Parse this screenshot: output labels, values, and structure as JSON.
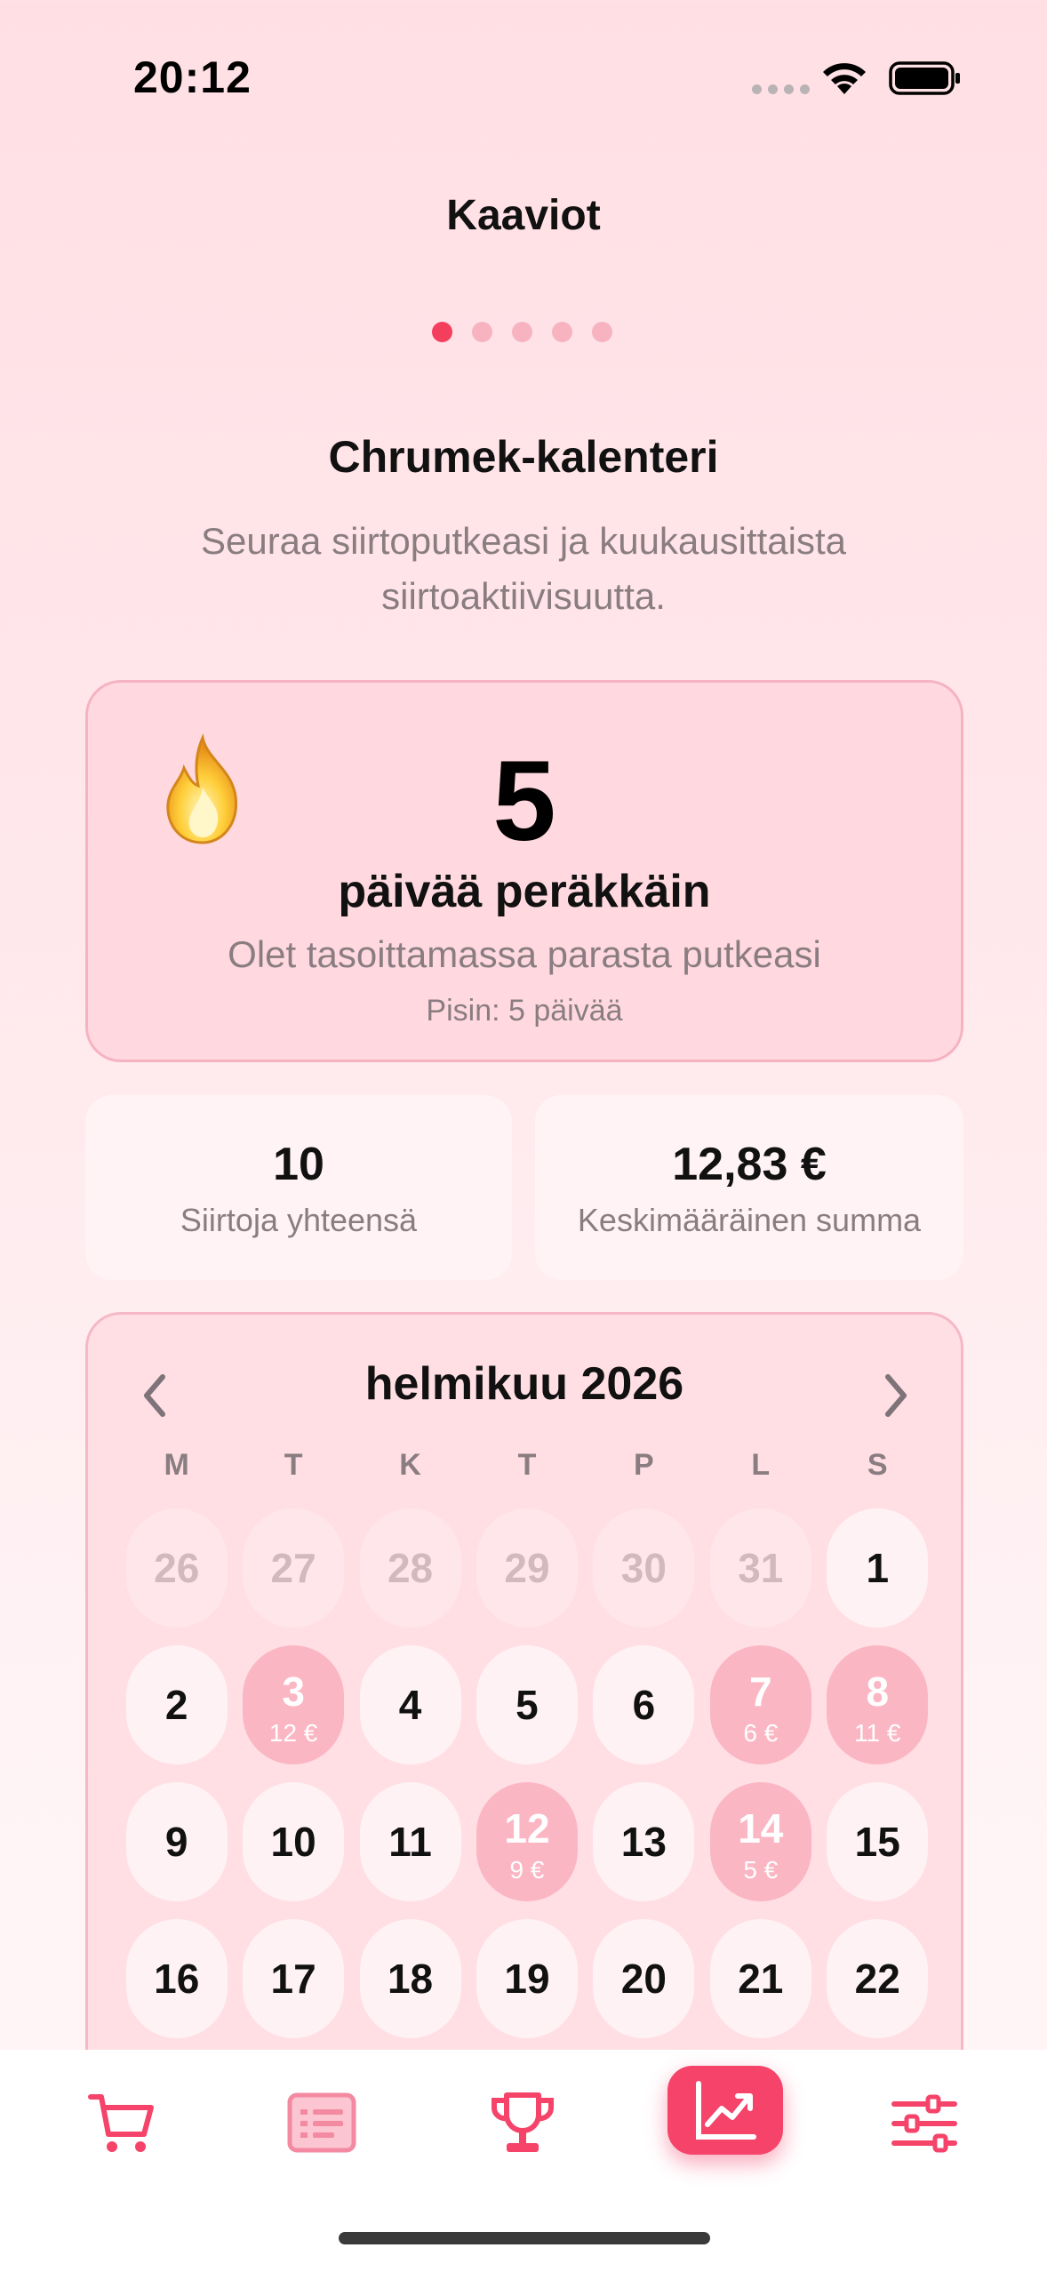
{
  "status_bar": {
    "time": "20:12"
  },
  "header": {
    "title": "Kaaviot"
  },
  "pager": {
    "count": 5,
    "active_index": 0
  },
  "section": {
    "title": "Chrumek-kalenteri",
    "subtitle": "Seuraa siirtoputkeasi ja kuukausittaista siirtoaktiivisuutta."
  },
  "streak": {
    "icon": "fire-icon",
    "value": "5",
    "label": "päivää peräkkäin",
    "message": "Olet tasoittamassa parasta putkeasi",
    "best": "Pisin: 5 päivää"
  },
  "stats": {
    "total_value": "10",
    "total_label": "Siirtoja yhteensä",
    "average_value": "12,83 €",
    "average_label": "Keskimääräinen summa"
  },
  "calendar": {
    "month": "helmikuu 2026",
    "weekdays": [
      "M",
      "T",
      "K",
      "T",
      "P",
      "L",
      "S"
    ],
    "rows": [
      [
        {
          "d": "26",
          "m": true
        },
        {
          "d": "27",
          "m": true
        },
        {
          "d": "28",
          "m": true
        },
        {
          "d": "29",
          "m": true
        },
        {
          "d": "30",
          "m": true
        },
        {
          "d": "31",
          "m": true
        },
        {
          "d": "1"
        }
      ],
      [
        {
          "d": "2"
        },
        {
          "d": "3",
          "a": "12 €"
        },
        {
          "d": "4"
        },
        {
          "d": "5"
        },
        {
          "d": "6"
        },
        {
          "d": "7",
          "a": "6 €"
        },
        {
          "d": "8",
          "a": "11 €"
        }
      ],
      [
        {
          "d": "9"
        },
        {
          "d": "10"
        },
        {
          "d": "11"
        },
        {
          "d": "12",
          "a": "9 €"
        },
        {
          "d": "13"
        },
        {
          "d": "14",
          "a": "5 €"
        },
        {
          "d": "15"
        }
      ],
      [
        {
          "d": "16"
        },
        {
          "d": "17"
        },
        {
          "d": "18"
        },
        {
          "d": "19"
        },
        {
          "d": "20"
        },
        {
          "d": "21"
        },
        {
          "d": "22"
        }
      ]
    ]
  },
  "tabbar": {
    "items": [
      {
        "icon": "cart-icon"
      },
      {
        "icon": "list-icon"
      },
      {
        "icon": "trophy-icon"
      },
      {
        "icon": "chart-icon",
        "active": true
      },
      {
        "icon": "sliders-icon"
      }
    ],
    "accent": "#f5436a"
  },
  "colors": {
    "accent": "#f43e5e",
    "card_pink": "#ffd9df",
    "muted_text": "#8a7d82"
  }
}
